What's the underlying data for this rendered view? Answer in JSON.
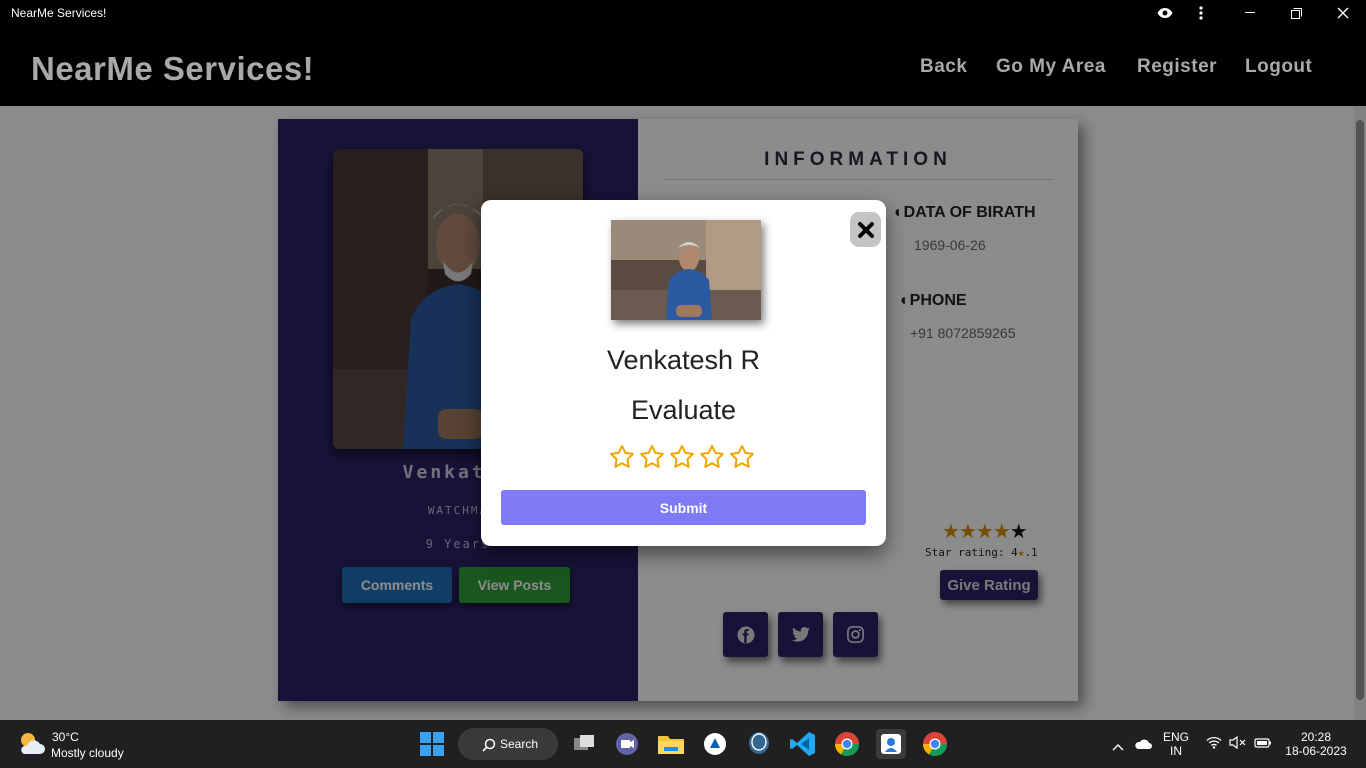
{
  "window": {
    "title": "NearMe Services!"
  },
  "header": {
    "brand": "NearMe Services!",
    "nav": [
      "Back",
      "Go My Area",
      "Register",
      "Logout"
    ]
  },
  "profile": {
    "name": "Venkates",
    "role": "WATCHMA",
    "experience": "9 Years",
    "comments_label": "Comments",
    "posts_label": "View Posts"
  },
  "info": {
    "heading": "INFORMATION",
    "dob_label": "◐DATA OF BIRATH",
    "dob_value": "1969-06-26",
    "phone_label": "◐PHONE",
    "phone_value": "+91 8072859265",
    "rating_stars_filled": 4,
    "rating_stars_total": 5,
    "star_rating_prefix": "Star rating: 4",
    "star_rating_suffix": ".1",
    "give_rating_label": "Give Rating",
    "social": [
      "facebook-icon",
      "twitter-icon",
      "instagram-icon"
    ]
  },
  "modal": {
    "name": "Venkatesh R",
    "title": "Evaluate",
    "star_count": 5,
    "selected_stars": 0,
    "submit_label": "Submit",
    "accent": "#7f7bf7"
  },
  "taskbar": {
    "temp": "30°C",
    "weather": "Mostly cloudy",
    "search": "Search",
    "lang1": "ENG",
    "lang2": "IN",
    "time": "20:28",
    "date": "18-06-2023"
  }
}
